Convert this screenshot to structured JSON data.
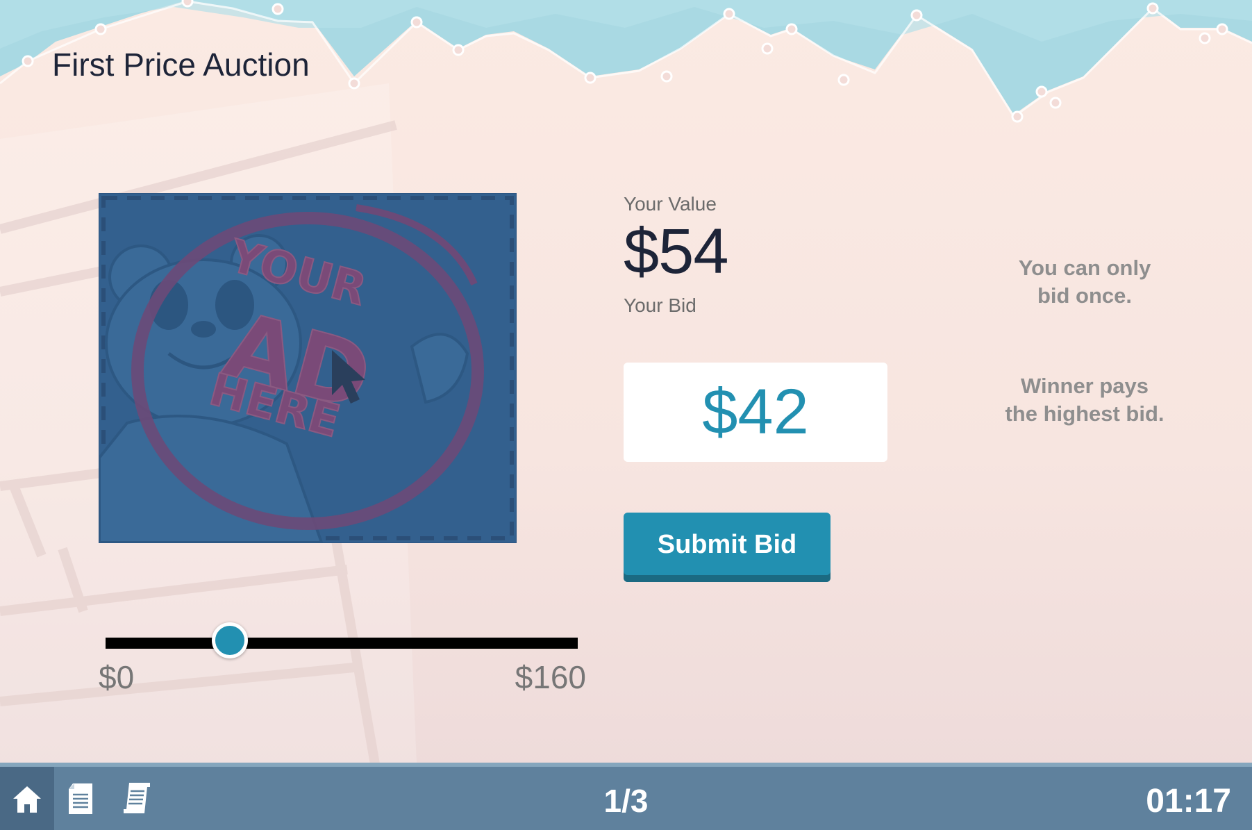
{
  "header": {
    "title": "First Price Auction"
  },
  "ad": {
    "text_line1": "YOUR",
    "text_line2": "AD",
    "text_line3": "HERE"
  },
  "slider": {
    "min_label": "$0",
    "max_label": "$160",
    "min": 0,
    "max": 160,
    "value": 42
  },
  "value_panel": {
    "value_label": "Your Value",
    "value_amount": "$54",
    "bid_label": "Your Bid",
    "bid_amount": "$42"
  },
  "actions": {
    "submit_label": "Submit Bid"
  },
  "hints": {
    "hint1_line1": "You can only",
    "hint1_line2": "bid once.",
    "hint2_line1": "Winner pays",
    "hint2_line2": "the highest bid."
  },
  "footer": {
    "page_counter": "1/3",
    "timer": "01:17",
    "icons": [
      "home-icon",
      "notes-icon",
      "receipt-icon"
    ]
  },
  "colors": {
    "accent": "#2290b1",
    "footer": "#5f819d",
    "title": "#1d2438",
    "ad_background": "#33608e"
  }
}
